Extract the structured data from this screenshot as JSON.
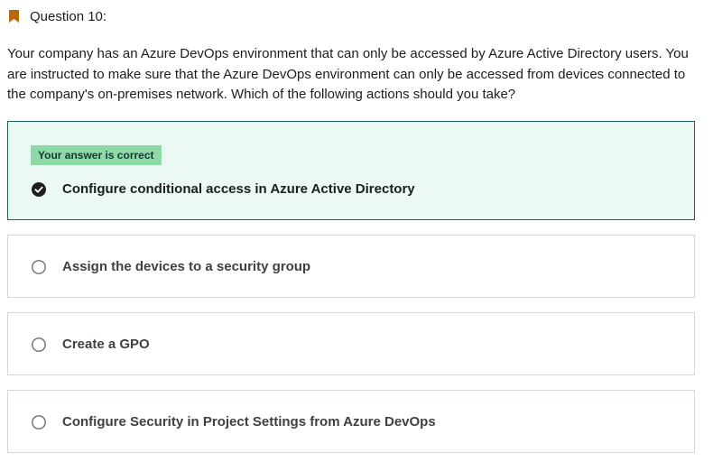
{
  "question": {
    "number_label": "Question 10:",
    "text": "Your company has an Azure DevOps environment that can only be accessed by Azure Active Directory users. You are instructed to make sure that the Azure DevOps environment can only be accessed from devices connected to the company's on-premises network. Which of the following actions should you take?",
    "bookmark_icon": "bookmark-icon"
  },
  "options": [
    {
      "label": "Configure conditional access in Azure Active Directory",
      "selected": true,
      "correct": true,
      "badge": "Your answer is correct",
      "icon": "check-circle-icon"
    },
    {
      "label": "Assign the devices to a security group",
      "selected": false,
      "icon": "radio-empty-icon"
    },
    {
      "label": "Create a GPO",
      "selected": false,
      "icon": "radio-empty-icon"
    },
    {
      "label": "Configure Security in Project Settings from Azure DevOps",
      "selected": false,
      "icon": "radio-empty-icon"
    }
  ],
  "colors": {
    "bookmark": "#b4690e",
    "correct_bg": "#ebf8f3",
    "correct_border": "#1e6055",
    "badge_bg": "#8fd9a9",
    "text": "#1c1d1f"
  }
}
